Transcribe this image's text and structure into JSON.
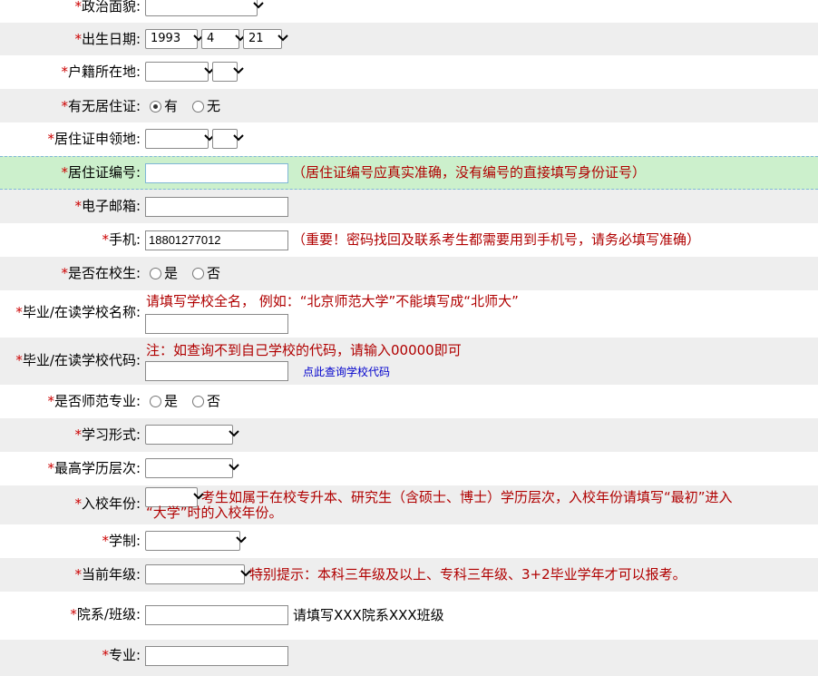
{
  "fields": {
    "political": {
      "label": "政治面貌:"
    },
    "birth": {
      "label": "出生日期:",
      "year": "1993",
      "month": "4",
      "day": "21"
    },
    "hukou": {
      "label": "户籍所在地:"
    },
    "has_permit": {
      "label": "有无居住证:",
      "opt_yes": "有",
      "opt_no": "无",
      "selected": "有"
    },
    "permit_place": {
      "label": "居住证申领地:"
    },
    "permit_no": {
      "label": "居住证编号:",
      "value": "",
      "note": "（居住证编号应真实准确，没有编号的直接填写身份证号）"
    },
    "email": {
      "label": "电子邮箱:",
      "value": ""
    },
    "phone": {
      "label": "手机:",
      "value": "18801277012",
      "note": "（重要！密码找回及联系考生都需要用到手机号，请务必填写准确）"
    },
    "in_school": {
      "label": "是否在校生:",
      "opt_yes": "是",
      "opt_no": "否"
    },
    "school_name": {
      "label": "毕业/在读学校名称:",
      "note": "请填写学校全名，  例如：“北京师范大学”不能填写成“北师大”",
      "value": ""
    },
    "school_code": {
      "label": "毕业/在读学校代码:",
      "note": "注：如查询不到自己学校的代码，请输入00000即可",
      "value": "",
      "link": "点此查询学校代码"
    },
    "normal_major": {
      "label": "是否师范专业:",
      "opt_yes": "是",
      "opt_no": "否"
    },
    "study_form": {
      "label": "学习形式:"
    },
    "highest_edu": {
      "label": "最高学历层次:"
    },
    "enroll_year": {
      "label": "入校年份:",
      "note_line1": "考生如属于在校专升本、研究生（含硕士、博士）学历层次，入校年份请填写“最初”进入",
      "note_line2": "“大学”时的入校年份。"
    },
    "schooling": {
      "label": "学制:"
    },
    "grade": {
      "label": "当前年级:",
      "note": "特别提示：本科三年级及以上、专科三年级、3+2毕业学年才可以报考。"
    },
    "department": {
      "label": "院系/班级:",
      "value": "",
      "hint": "请填写XXX院系XXX班级"
    },
    "major": {
      "label": "专业:",
      "value": ""
    }
  },
  "required_mark": "*",
  "colors": {
    "required": "#cc0000",
    "note": "#b00000",
    "highlight_row": "#ccf0cc",
    "alt_row": "#eeeeee",
    "link": "#0000cc"
  }
}
